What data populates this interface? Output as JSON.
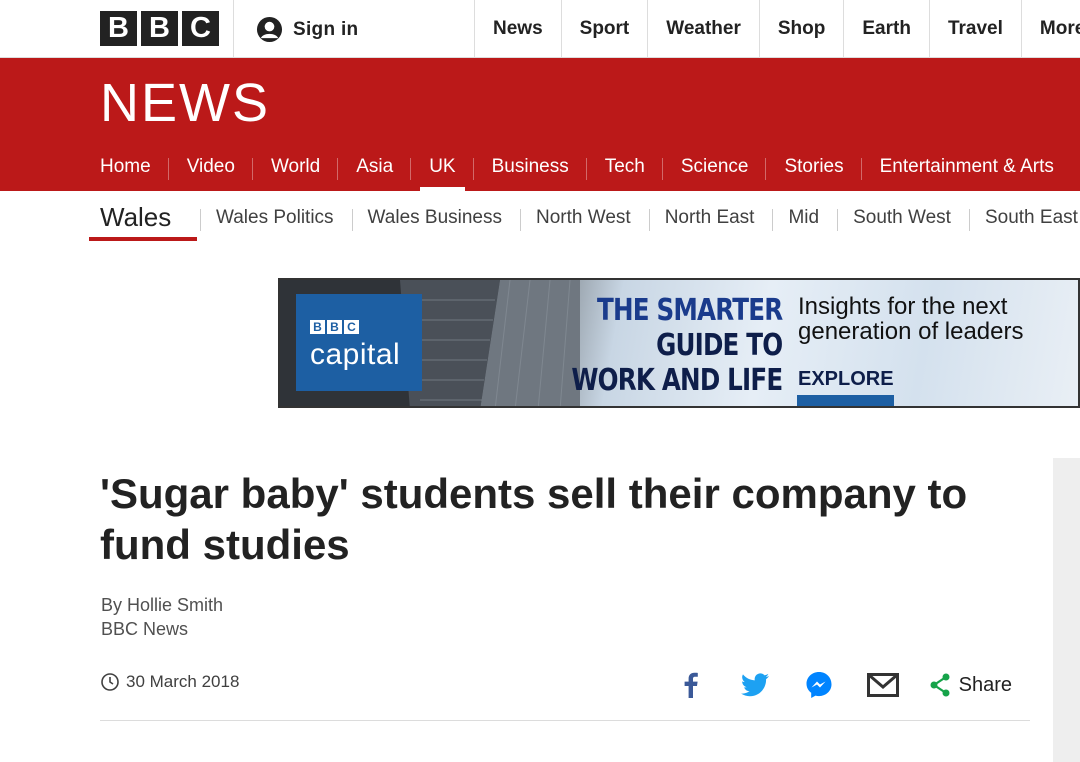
{
  "top": {
    "logo_letters": [
      "B",
      "B",
      "C"
    ],
    "signin_label": "Sign in",
    "nav": [
      "News",
      "Sport",
      "Weather",
      "Shop",
      "Earth",
      "Travel",
      "More"
    ]
  },
  "news_header": {
    "title": "NEWS",
    "nav": [
      "Home",
      "Video",
      "World",
      "Asia",
      "UK",
      "Business",
      "Tech",
      "Science",
      "Stories",
      "Entertainment & Arts"
    ],
    "active_item": "UK",
    "bg_color": "#bb1919"
  },
  "subnav": {
    "current": "Wales",
    "items": [
      "Wales Politics",
      "Wales Business",
      "North West",
      "North East",
      "Mid",
      "South West",
      "South East"
    ]
  },
  "ad": {
    "brand_letters": [
      "B",
      "B",
      "C"
    ],
    "brand_name": "capital",
    "headline_lines": [
      "THE SMARTER",
      "GUIDE TO",
      "WORK AND LIFE"
    ],
    "tagline_lines": [
      "Insights for the next",
      "generation of leaders"
    ],
    "cta": "EXPLORE"
  },
  "article": {
    "headline": "'Sugar baby' students sell their company to fund studies",
    "author": "By Hollie Smith",
    "publication": "BBC News",
    "date": "30 March 2018",
    "share_label": "Share",
    "share_icons": [
      "facebook-icon",
      "twitter-icon",
      "messenger-icon",
      "email-icon",
      "share-icon"
    ]
  },
  "colors": {
    "facebook": "#3b5998",
    "twitter": "#1da1f2",
    "messenger": "#0084ff",
    "share_green": "#16a34a"
  }
}
